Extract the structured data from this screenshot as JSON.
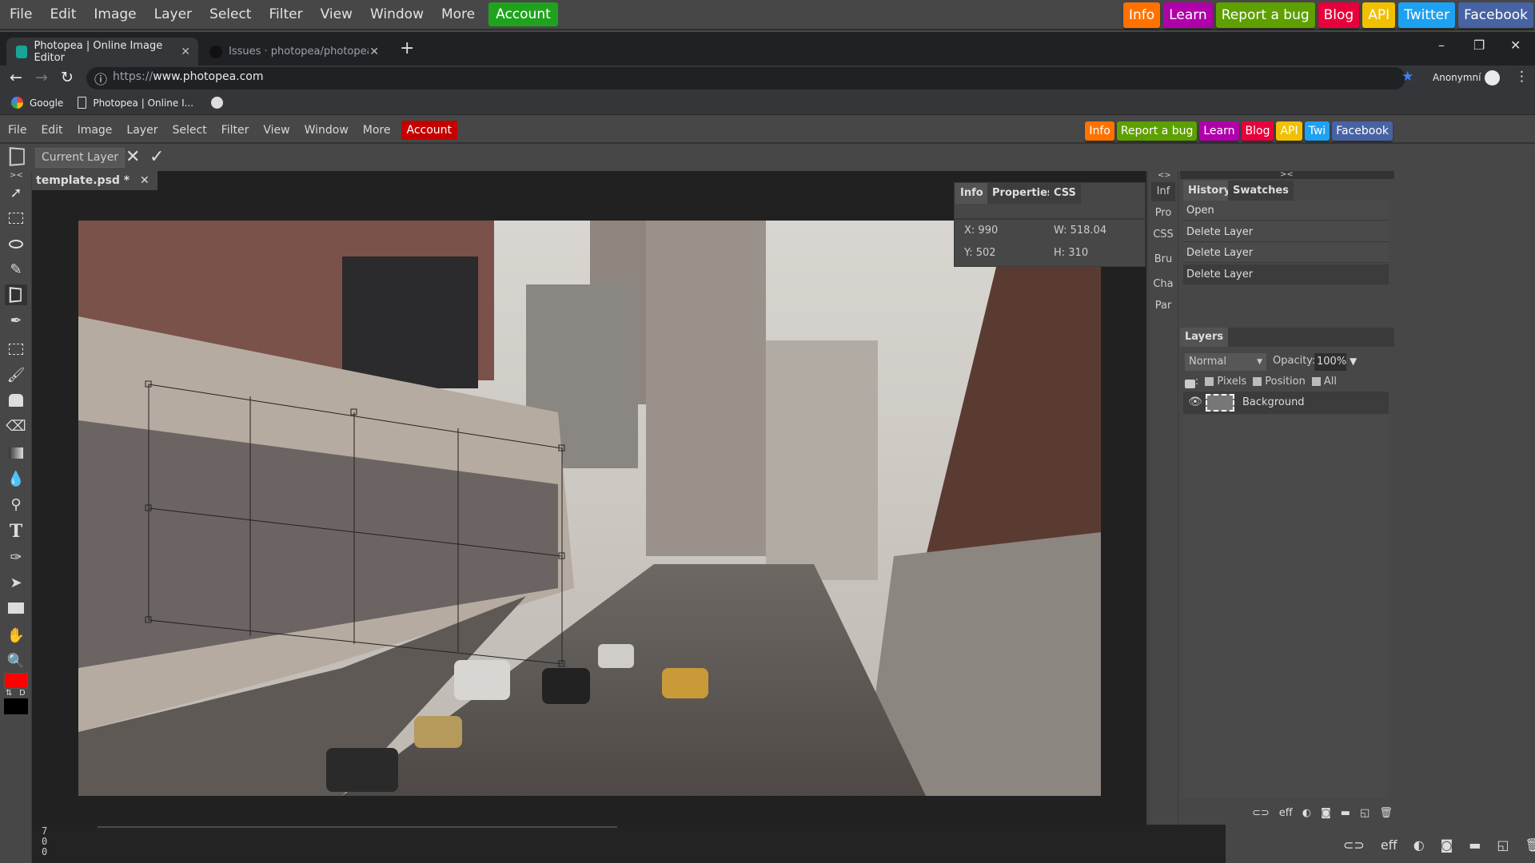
{
  "outer_menu": {
    "items": [
      "File",
      "Edit",
      "Image",
      "Layer",
      "Select",
      "Filter",
      "View",
      "Window",
      "More"
    ],
    "account_label": "Account",
    "links": [
      {
        "label": "Info",
        "color": "#ff7200"
      },
      {
        "label": "Learn",
        "color": "#b000aa"
      },
      {
        "label": "Report a bug",
        "color": "#5ea000"
      },
      {
        "label": "Blog",
        "color": "#e8003c"
      },
      {
        "label": "API",
        "color": "#f1c000"
      },
      {
        "label": "Twitter",
        "color": "#1da1f2"
      },
      {
        "label": "Facebook",
        "color": "#4763a3"
      }
    ]
  },
  "browser": {
    "tabs": [
      {
        "title": "Photopea | Online Image Editor",
        "active": true,
        "close": "✕"
      },
      {
        "title": "Issues · photopea/photopea · Gi",
        "active": false,
        "close": "✕"
      }
    ],
    "new_tab": "+",
    "window_controls": {
      "minimize": "–",
      "restore": "❐",
      "close": "✕"
    },
    "nav": {
      "back": "←",
      "forward": "→",
      "reload": "↻",
      "site_info": "ⓘ"
    },
    "url_scheme": "https://",
    "url_host": "www.photopea.com",
    "profile_label": "Anonymní",
    "bookmarks": [
      {
        "label": "Google",
        "icon": "google-icon"
      },
      {
        "label": "Photopea | Online I...",
        "icon": "page-icon"
      }
    ]
  },
  "inner_menu": {
    "items": [
      "File",
      "Edit",
      "Image",
      "Layer",
      "Select",
      "Filter",
      "View",
      "Window",
      "More"
    ],
    "account_label": "Account",
    "links": [
      {
        "label": "Info",
        "color": "#ff7200"
      },
      {
        "label": "Report a bug",
        "color": "#5ea000"
      },
      {
        "label": "Learn",
        "color": "#b000aa"
      },
      {
        "label": "Blog",
        "color": "#e8003c"
      },
      {
        "label": "API",
        "color": "#f1c000"
      },
      {
        "label": "Twi",
        "color": "#1da1f2"
      },
      {
        "label": "Facebook",
        "color": "#4763a3"
      }
    ]
  },
  "options_bar": {
    "target_label": "Current Layer",
    "cancel": "✕",
    "commit": "✓"
  },
  "document": {
    "tab_label": "template.psd *",
    "tab_close": "✕"
  },
  "info_panel": {
    "tabs": [
      "Info",
      "Properties",
      "CSS"
    ],
    "x": "X: 990",
    "y": "Y: 502",
    "w": "W: 518.04",
    "h": "H: 310"
  },
  "collapsed_panels": [
    "Inf",
    "Pro",
    "CSS",
    "Bru",
    "Cha",
    "Par"
  ],
  "history_panel": {
    "tabs": [
      "History",
      "Swatches"
    ],
    "items": [
      "Open",
      "Delete Layer",
      "Delete Layer",
      "Delete Layer"
    ]
  },
  "layers_panel": {
    "title": "Layers",
    "blend_mode": "Normal",
    "opacity_label": "Opacity:",
    "opacity_value": "100%",
    "lock_options": [
      "Pixels",
      "Position",
      "All"
    ],
    "layers": [
      {
        "name": "Background",
        "visible": true
      }
    ]
  },
  "layer_footer_icons": [
    "link-icon",
    "eff",
    "adjustment-icon",
    "mask-icon",
    "folder-icon",
    "new-layer-icon",
    "trash-icon"
  ],
  "ruler_readout": "700",
  "colors": {
    "foreground": "#ff0000",
    "background": "#000000"
  }
}
